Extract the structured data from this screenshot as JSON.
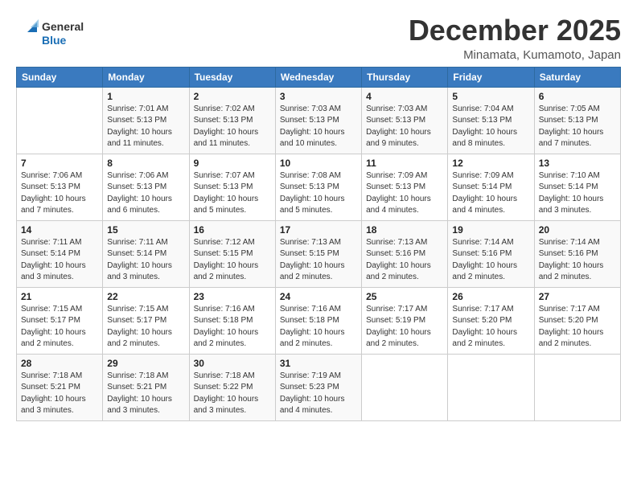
{
  "logo": {
    "line1": "General",
    "line2": "Blue"
  },
  "header": {
    "month": "December 2025",
    "location": "Minamata, Kumamoto, Japan"
  },
  "days_of_week": [
    "Sunday",
    "Monday",
    "Tuesday",
    "Wednesday",
    "Thursday",
    "Friday",
    "Saturday"
  ],
  "weeks": [
    [
      {
        "day": "",
        "info": ""
      },
      {
        "day": "1",
        "info": "Sunrise: 7:01 AM\nSunset: 5:13 PM\nDaylight: 10 hours\nand 11 minutes."
      },
      {
        "day": "2",
        "info": "Sunrise: 7:02 AM\nSunset: 5:13 PM\nDaylight: 10 hours\nand 11 minutes."
      },
      {
        "day": "3",
        "info": "Sunrise: 7:03 AM\nSunset: 5:13 PM\nDaylight: 10 hours\nand 10 minutes."
      },
      {
        "day": "4",
        "info": "Sunrise: 7:03 AM\nSunset: 5:13 PM\nDaylight: 10 hours\nand 9 minutes."
      },
      {
        "day": "5",
        "info": "Sunrise: 7:04 AM\nSunset: 5:13 PM\nDaylight: 10 hours\nand 8 minutes."
      },
      {
        "day": "6",
        "info": "Sunrise: 7:05 AM\nSunset: 5:13 PM\nDaylight: 10 hours\nand 7 minutes."
      }
    ],
    [
      {
        "day": "7",
        "info": "Sunrise: 7:06 AM\nSunset: 5:13 PM\nDaylight: 10 hours\nand 7 minutes."
      },
      {
        "day": "8",
        "info": "Sunrise: 7:06 AM\nSunset: 5:13 PM\nDaylight: 10 hours\nand 6 minutes."
      },
      {
        "day": "9",
        "info": "Sunrise: 7:07 AM\nSunset: 5:13 PM\nDaylight: 10 hours\nand 5 minutes."
      },
      {
        "day": "10",
        "info": "Sunrise: 7:08 AM\nSunset: 5:13 PM\nDaylight: 10 hours\nand 5 minutes."
      },
      {
        "day": "11",
        "info": "Sunrise: 7:09 AM\nSunset: 5:13 PM\nDaylight: 10 hours\nand 4 minutes."
      },
      {
        "day": "12",
        "info": "Sunrise: 7:09 AM\nSunset: 5:14 PM\nDaylight: 10 hours\nand 4 minutes."
      },
      {
        "day": "13",
        "info": "Sunrise: 7:10 AM\nSunset: 5:14 PM\nDaylight: 10 hours\nand 3 minutes."
      }
    ],
    [
      {
        "day": "14",
        "info": "Sunrise: 7:11 AM\nSunset: 5:14 PM\nDaylight: 10 hours\nand 3 minutes."
      },
      {
        "day": "15",
        "info": "Sunrise: 7:11 AM\nSunset: 5:14 PM\nDaylight: 10 hours\nand 3 minutes."
      },
      {
        "day": "16",
        "info": "Sunrise: 7:12 AM\nSunset: 5:15 PM\nDaylight: 10 hours\nand 2 minutes."
      },
      {
        "day": "17",
        "info": "Sunrise: 7:13 AM\nSunset: 5:15 PM\nDaylight: 10 hours\nand 2 minutes."
      },
      {
        "day": "18",
        "info": "Sunrise: 7:13 AM\nSunset: 5:16 PM\nDaylight: 10 hours\nand 2 minutes."
      },
      {
        "day": "19",
        "info": "Sunrise: 7:14 AM\nSunset: 5:16 PM\nDaylight: 10 hours\nand 2 minutes."
      },
      {
        "day": "20",
        "info": "Sunrise: 7:14 AM\nSunset: 5:16 PM\nDaylight: 10 hours\nand 2 minutes."
      }
    ],
    [
      {
        "day": "21",
        "info": "Sunrise: 7:15 AM\nSunset: 5:17 PM\nDaylight: 10 hours\nand 2 minutes."
      },
      {
        "day": "22",
        "info": "Sunrise: 7:15 AM\nSunset: 5:17 PM\nDaylight: 10 hours\nand 2 minutes."
      },
      {
        "day": "23",
        "info": "Sunrise: 7:16 AM\nSunset: 5:18 PM\nDaylight: 10 hours\nand 2 minutes."
      },
      {
        "day": "24",
        "info": "Sunrise: 7:16 AM\nSunset: 5:18 PM\nDaylight: 10 hours\nand 2 minutes."
      },
      {
        "day": "25",
        "info": "Sunrise: 7:17 AM\nSunset: 5:19 PM\nDaylight: 10 hours\nand 2 minutes."
      },
      {
        "day": "26",
        "info": "Sunrise: 7:17 AM\nSunset: 5:20 PM\nDaylight: 10 hours\nand 2 minutes."
      },
      {
        "day": "27",
        "info": "Sunrise: 7:17 AM\nSunset: 5:20 PM\nDaylight: 10 hours\nand 2 minutes."
      }
    ],
    [
      {
        "day": "28",
        "info": "Sunrise: 7:18 AM\nSunset: 5:21 PM\nDaylight: 10 hours\nand 3 minutes."
      },
      {
        "day": "29",
        "info": "Sunrise: 7:18 AM\nSunset: 5:21 PM\nDaylight: 10 hours\nand 3 minutes."
      },
      {
        "day": "30",
        "info": "Sunrise: 7:18 AM\nSunset: 5:22 PM\nDaylight: 10 hours\nand 3 minutes."
      },
      {
        "day": "31",
        "info": "Sunrise: 7:19 AM\nSunset: 5:23 PM\nDaylight: 10 hours\nand 4 minutes."
      },
      {
        "day": "",
        "info": ""
      },
      {
        "day": "",
        "info": ""
      },
      {
        "day": "",
        "info": ""
      }
    ]
  ]
}
